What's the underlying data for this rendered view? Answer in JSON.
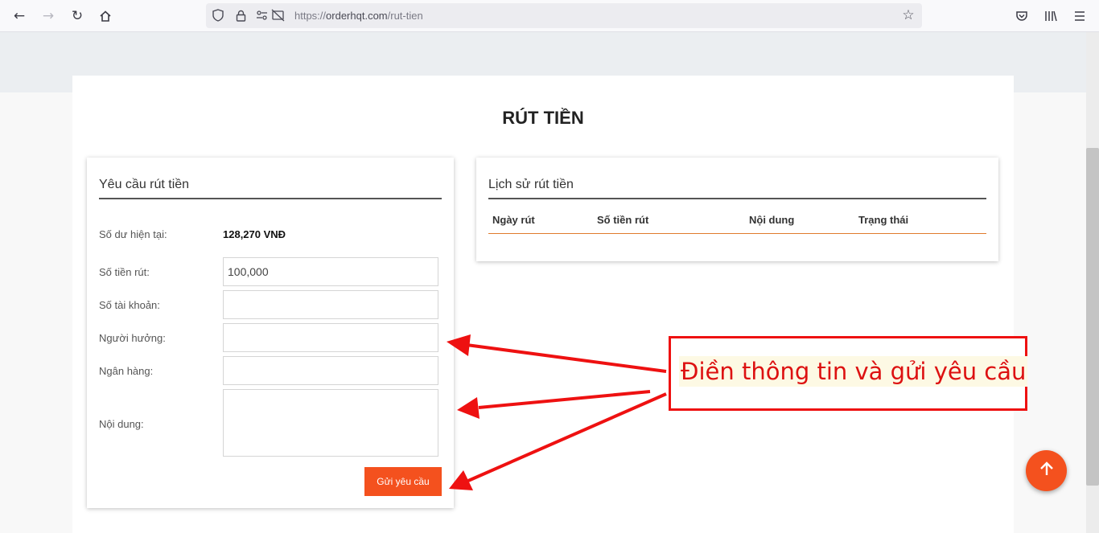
{
  "browser": {
    "url_prefix": "https://",
    "url_host": "orderhqt.com",
    "url_path": "/rut-tien"
  },
  "page": {
    "title": "RÚT TIỀN"
  },
  "withdraw_form": {
    "heading": "Yêu cầu rút tiền",
    "balance_label": "Số dư hiện tại:",
    "balance_value": "128,270 VNĐ",
    "amount_label": "Số tiền rút:",
    "amount_value": "100,000",
    "account_label": "Số tài khoản:",
    "beneficiary_label": "Người hưởng:",
    "bank_label": "Ngân hàng:",
    "content_label": "Nội dung:",
    "submit_label": "Gửi yêu cầu"
  },
  "history": {
    "heading": "Lịch sử rút tiền",
    "columns": [
      "Ngày rút",
      "Số tiền rút",
      "Nội dung",
      "Trạng thái"
    ]
  },
  "annotation": {
    "text": "Điền thông tin và gửi yêu cầu",
    "color": "#ee1111"
  },
  "theme": {
    "accent": "#f4511e"
  },
  "icons": {
    "back": "arrow-left-icon",
    "forward": "arrow-right-icon",
    "reload": "reload-icon",
    "home": "home-icon",
    "shield": "shield-icon",
    "lock": "lock-icon",
    "permissions": "permissions-icon",
    "bookmark": "star-icon",
    "pocket": "pocket-icon",
    "library": "library-icon",
    "menu": "hamburger-menu-icon",
    "scroll_top": "arrow-up-icon"
  }
}
